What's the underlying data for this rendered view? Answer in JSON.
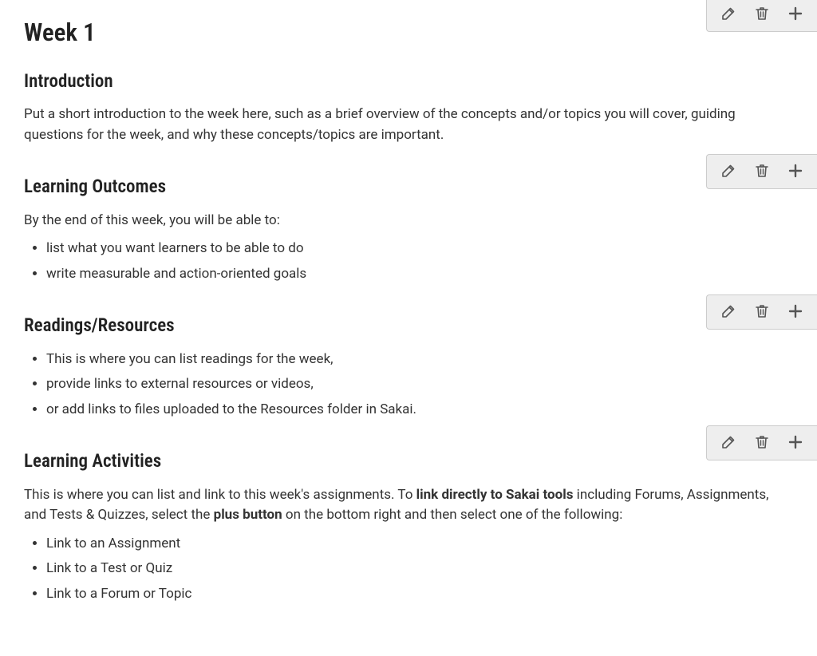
{
  "page_title": "Week 1",
  "sections": {
    "introduction": {
      "heading": "Introduction",
      "body": "Put a short introduction to the week here, such as a brief overview of the concepts and/or topics you will cover, guiding questions for the week, and why these concepts/topics are important."
    },
    "outcomes": {
      "heading": "Learning Outcomes",
      "intro": "By the end of this week, you will be able to:",
      "items": [
        "list what you want learners to be able to do",
        "write measurable and action-oriented goals"
      ]
    },
    "readings": {
      "heading": "Readings/Resources",
      "items": [
        "This is where you can list readings for the week,",
        "provide links to external resources or videos,",
        "or add links to files uploaded to the Resources folder in Sakai."
      ]
    },
    "activities": {
      "heading": "Learning Activities",
      "intro_pre": "This is where you can list and link to this week's assignments. To ",
      "intro_bold1": "link directly to Sakai tools",
      "intro_mid": " including Forums, Assignments, and Tests & Quizzes, select the ",
      "intro_bold2": "plus button",
      "intro_post": " on the bottom right and then select one of the following:",
      "items": [
        "Link to an Assignment",
        "Link to a Test or Quiz",
        "Link to a Forum or Topic"
      ]
    }
  },
  "toolbar": {
    "edit": "Edit",
    "delete": "Delete",
    "add": "Add"
  }
}
